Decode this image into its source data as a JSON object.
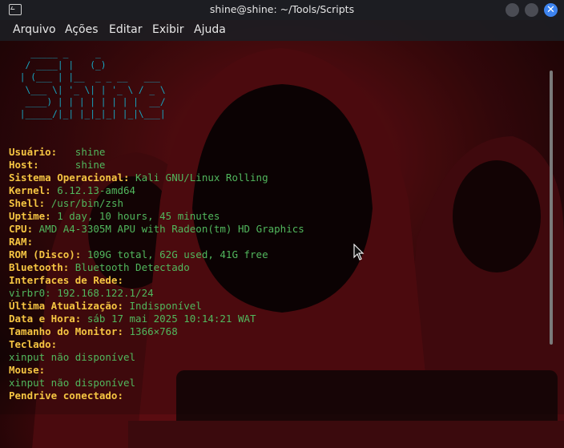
{
  "window": {
    "title": "shine@shine: ~/Tools/Scripts"
  },
  "menu": [
    "Arquivo",
    "Ações",
    "Editar",
    "Exibir",
    "Ajuda"
  ],
  "ascii_logo": "   _____ _     _\n  / ____| |   (_)\n | (___ | |__  _ _ __   ___\n  \\___ \\| '_ \\| | '_ \\ / _ \\\n  ____) | | | | | | | |  __/\n |_____/|_| |_|_|_| |_|\\___|",
  "rows": [
    {
      "key": "Usuário:",
      "sep": "   ",
      "value": "shine"
    },
    {
      "key": "Host:",
      "sep": "      ",
      "value": "shine"
    },
    {
      "key": "Sistema Operacional:",
      "sep": " ",
      "value": "Kali GNU/Linux Rolling"
    },
    {
      "key": "Kernel:",
      "sep": " ",
      "value": "6.12.13-amd64"
    },
    {
      "key": "Shell:",
      "sep": " ",
      "value": "/usr/bin/zsh"
    },
    {
      "key": "Uptime:",
      "sep": " ",
      "value": "1 day, 10 hours, 45 minutes"
    },
    {
      "key": "CPU:",
      "sep": " ",
      "value": "AMD A4-3305M APU with Radeon(tm) HD Graphics"
    },
    {
      "key": "RAM:",
      "sep": "",
      "value": ""
    },
    {
      "key": "ROM (Disco):",
      "sep": " ",
      "value": "109G total, 62G used, 41G free"
    },
    {
      "key": "Bluetooth:",
      "sep": " ",
      "value": "Bluetooth Detectado"
    },
    {
      "key": "Interfaces de Rede:",
      "sep": "",
      "value": ""
    },
    {
      "key": "",
      "sep": "",
      "value": "virbr0: 192.168.122.1/24"
    },
    {
      "key": "Última Atualização:",
      "sep": " ",
      "value": "Indisponível"
    },
    {
      "key": "Data e Hora:",
      "sep": " ",
      "value": "sáb 17 mai 2025 10:14:21 WAT"
    },
    {
      "key": "Tamanho do Monitor:",
      "sep": " ",
      "value": "1366×768"
    },
    {
      "key": "Teclado:",
      "sep": "",
      "value": ""
    },
    {
      "key": "",
      "sep": "",
      "value": "xinput não disponível"
    },
    {
      "key": "Mouse:",
      "sep": "",
      "value": ""
    },
    {
      "key": "",
      "sep": "",
      "value": "xinput não disponível"
    },
    {
      "key": "Pendrive conectado:",
      "sep": "",
      "value": ""
    }
  ],
  "colors": {
    "key": "#f5c542",
    "value": "#51b75d",
    "ascii": "#17a7c2",
    "close_button": "#3d84f0"
  },
  "icons": {
    "window": "terminal-icon",
    "minimize": "minimize-icon",
    "maximize": "maximize-icon",
    "close": "close-icon",
    "pointer": "mouse-pointer-icon"
  }
}
